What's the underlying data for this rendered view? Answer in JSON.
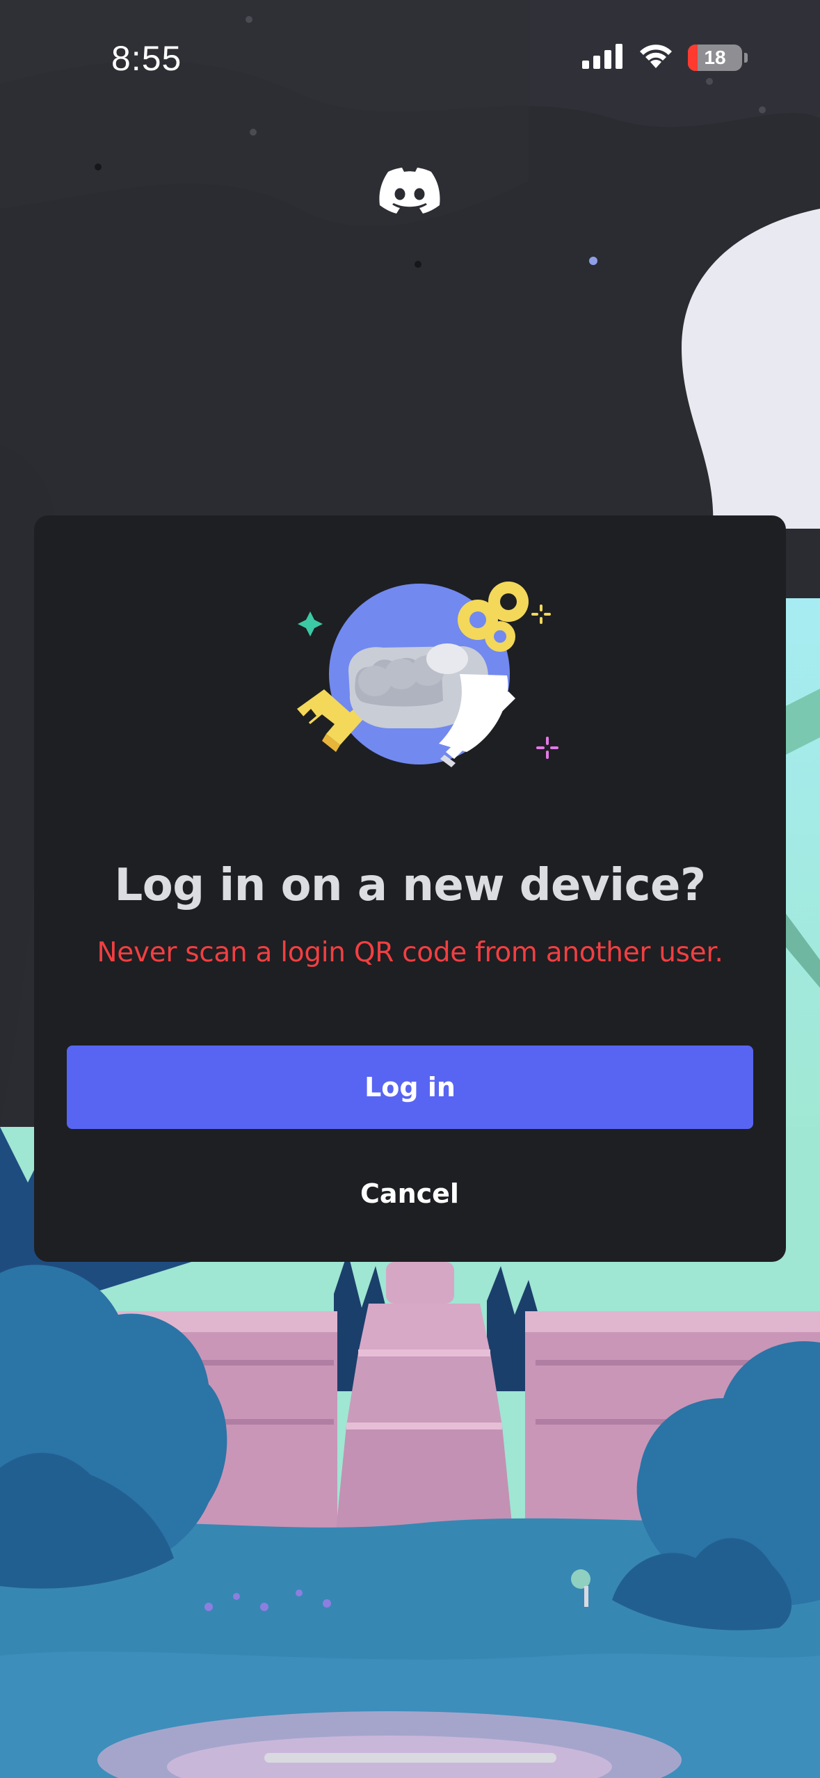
{
  "status_bar": {
    "time": "8:55",
    "battery_level": "18",
    "battery_fraction": 0.18,
    "icons": [
      "cellular-signal-icon",
      "wifi-icon",
      "battery-icon"
    ]
  },
  "app": {
    "logo_icon": "discord-logo-icon"
  },
  "dialog": {
    "illustration_icon": "hand-holding-key-illustration",
    "title": "Log in on a new device?",
    "warning": "Never scan a login QR code from another user.",
    "login_label": "Log in",
    "cancel_label": "Cancel"
  },
  "colors": {
    "background": "#2b2c31",
    "modal": "#1e1f22",
    "primary_button": "#5865f2",
    "warning_text": "#f23f42",
    "title_text": "#dcdde1",
    "wall": "#cfa0bf",
    "foliage": "#2b74a6",
    "ground": "#3787b3",
    "sky": "#a8e7e3"
  }
}
